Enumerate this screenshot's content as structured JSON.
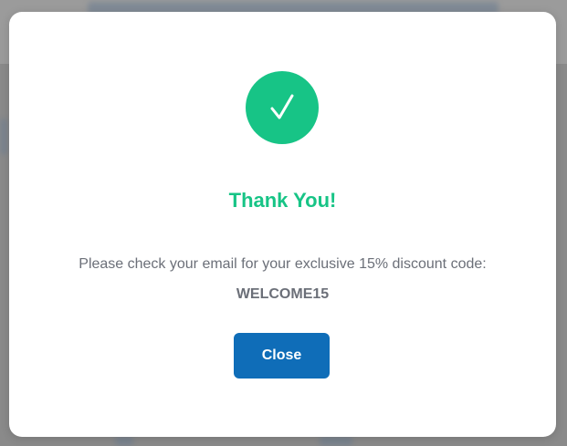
{
  "modal": {
    "title": "Thank You!",
    "message": "Please check your email for your exclusive 15% discount code:",
    "discount_code": "WELCOME15",
    "close_label": "Close",
    "icon": "check-icon"
  },
  "colors": {
    "success_green": "#17c486",
    "button_blue": "#0f6db8",
    "text_gray": "#6b6f78",
    "overlay": "#8a8a8a"
  }
}
